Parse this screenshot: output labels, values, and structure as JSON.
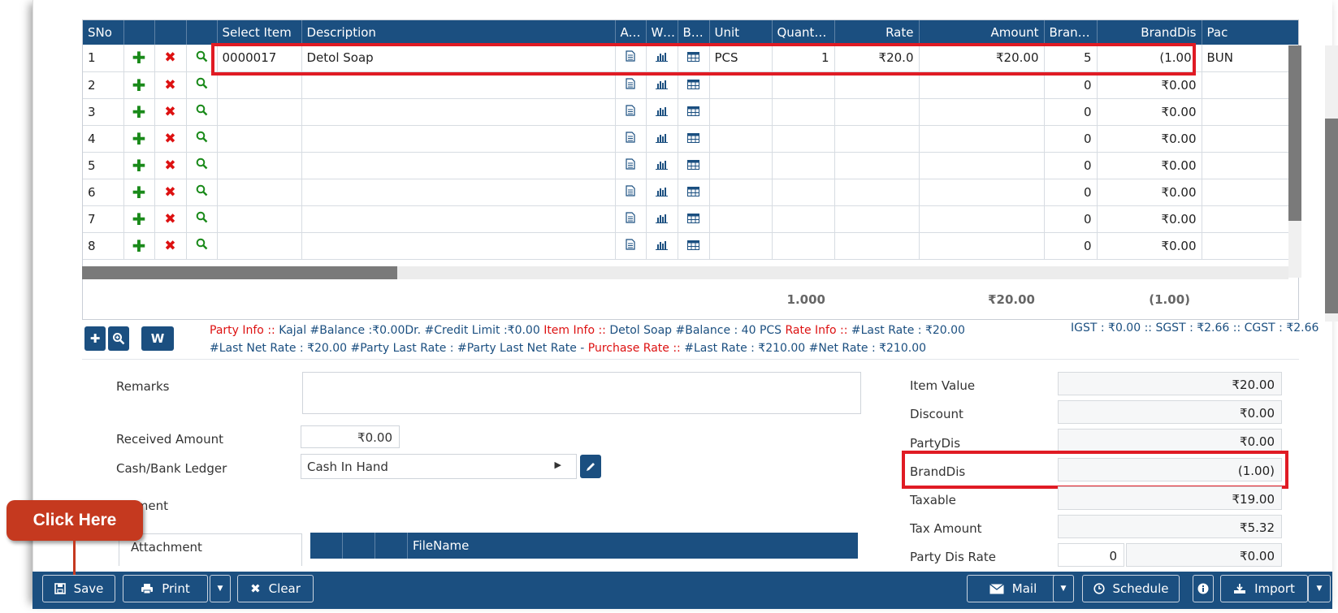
{
  "grid": {
    "headers": [
      "SNo",
      "",
      "",
      "",
      "Select Item",
      "Description",
      "At...",
      "Wi...",
      "Ba...",
      "Unit",
      "Quantity",
      "Rate",
      "Amount",
      "Brand...",
      "BrandDis",
      "Pac"
    ],
    "rows": [
      {
        "sno": "1",
        "item": "0000017",
        "desc": "Detol Soap",
        "unit": "PCS",
        "qty": "1",
        "rate": "₹20.0",
        "amount": "₹20.00",
        "brand": "5",
        "branddis": "(1.00)",
        "pack": "BUN"
      },
      {
        "sno": "2",
        "item": "",
        "desc": "",
        "unit": "",
        "qty": "",
        "rate": "",
        "amount": "",
        "brand": "0",
        "branddis": "₹0.00",
        "pack": ""
      },
      {
        "sno": "3",
        "item": "",
        "desc": "",
        "unit": "",
        "qty": "",
        "rate": "",
        "amount": "",
        "brand": "0",
        "branddis": "₹0.00",
        "pack": ""
      },
      {
        "sno": "4",
        "item": "",
        "desc": "",
        "unit": "",
        "qty": "",
        "rate": "",
        "amount": "",
        "brand": "0",
        "branddis": "₹0.00",
        "pack": ""
      },
      {
        "sno": "5",
        "item": "",
        "desc": "",
        "unit": "",
        "qty": "",
        "rate": "",
        "amount": "",
        "brand": "0",
        "branddis": "₹0.00",
        "pack": ""
      },
      {
        "sno": "6",
        "item": "",
        "desc": "",
        "unit": "",
        "qty": "",
        "rate": "",
        "amount": "",
        "brand": "0",
        "branddis": "₹0.00",
        "pack": ""
      },
      {
        "sno": "7",
        "item": "",
        "desc": "",
        "unit": "",
        "qty": "",
        "rate": "",
        "amount": "",
        "brand": "0",
        "branddis": "₹0.00",
        "pack": ""
      },
      {
        "sno": "8",
        "item": "",
        "desc": "",
        "unit": "",
        "qty": "",
        "rate": "",
        "amount": "",
        "brand": "0",
        "branddis": "₹0.00",
        "pack": ""
      }
    ],
    "icons": {
      "add": "plus-icon",
      "delete": "close-icon",
      "search": "search-icon",
      "attach": "document-icon",
      "wise": "bar-chart-icon",
      "batch": "table-icon"
    },
    "totals": {
      "quantity": "1.000",
      "amount": "₹20.00",
      "branddis": "(1.00)"
    }
  },
  "mini_buttons": {
    "w_label": "W"
  },
  "info_line": {
    "party_label": "Party Info ::",
    "party_text": " Kajal #Balance :₹0.00Dr. #Credit Limit :₹0.00 ",
    "item_label": "Item Info ::",
    "item_text": " Detol Soap #Balance : 40 PCS ",
    "rate_label": "Rate Info ::",
    "rate_text": " #Last Rate : ₹20.00 #Last Net Rate : ₹20.00 #Party Last Rate : #Party Last Net Rate - ",
    "purchase_label": "Purchase Rate ::",
    "purchase_text": " #Last Rate : ₹210.00 #Net Rate : ₹210.00"
  },
  "gst_line": "IGST : ₹0.00 :: SGST : ₹2.66 :: CGST : ₹2.66",
  "form": {
    "remarks_label": "Remarks",
    "remarks_value": "",
    "received_label": "Received Amount",
    "received_value": "₹0.00",
    "ledger_label": "Cash/Bank Ledger",
    "ledger_value": "Cash In Hand",
    "attachment_section": "chment",
    "attachment_tab": "Attachment",
    "file_col": "FileName"
  },
  "summary": {
    "item_value_label": "Item Value",
    "item_value": "₹20.00",
    "discount_label": "Discount",
    "discount": "₹0.00",
    "partydis_label": "PartyDis",
    "partydis": "₹0.00",
    "branddis_label": "BrandDis",
    "branddis": "(1.00)",
    "taxable_label": "Taxable",
    "taxable": "₹19.00",
    "tax_amount_label": "Tax Amount",
    "tax_amount": "₹5.32",
    "party_dis_rate_label": "Party Dis Rate",
    "party_dis_rate": "0",
    "party_dis_amount": "₹0.00"
  },
  "callout": "Click Here",
  "toolbar": {
    "save": "Save",
    "print": "Print",
    "clear": "Clear",
    "mail": "Mail",
    "schedule": "Schedule",
    "import": "Import"
  },
  "colors": {
    "primary": "#1b4f80",
    "highlight": "#e01b24",
    "callout": "#c5391f",
    "add": "#1a8a1a",
    "delete": "#dd1111"
  }
}
